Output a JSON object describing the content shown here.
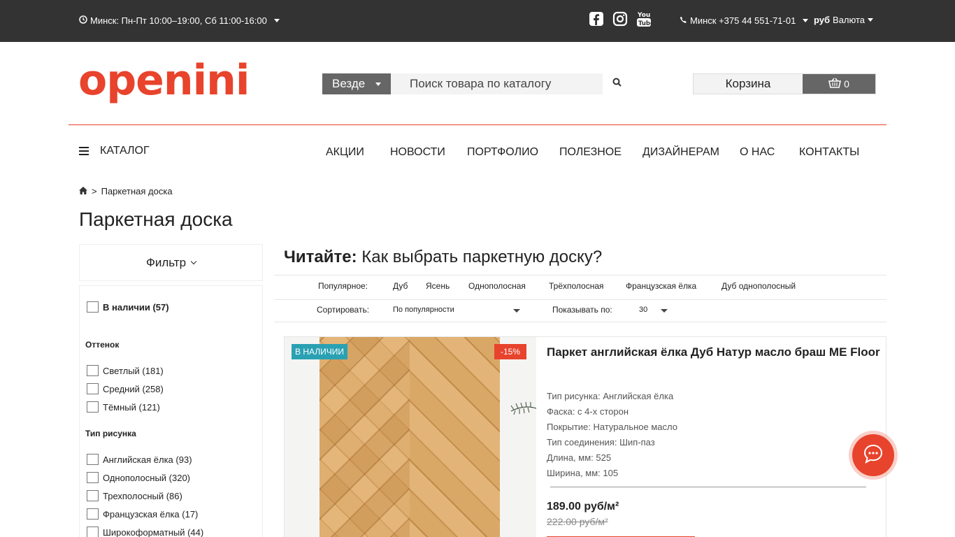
{
  "topbar": {
    "hours": "Минск: Пн-Пт 10:00–19:00, Сб 11:00-16:00",
    "phone": "Минск +375 44 551-71-01",
    "currency_code": "руб",
    "currency_label": "Валюта",
    "social_youtube_text": "You Tube"
  },
  "header": {
    "logo": "openini",
    "search_scope": "Везде",
    "search_placeholder": "Поиск товара по каталогу",
    "cart_label": "Корзина",
    "cart_count": "0"
  },
  "nav": {
    "catalog": "КАТАЛОГ",
    "items": [
      "АКЦИИ",
      "НОВОСТИ",
      "ПОРТФОЛИО",
      "ПОЛЕЗНОЕ",
      "ДИЗАЙНЕРАМ",
      "О НАС",
      "КОНТАКТЫ"
    ]
  },
  "breadcrumb": {
    "separator": ">",
    "current": "Паркетная доска"
  },
  "page_title": "Паркетная доска",
  "filter": {
    "toggle": "Фильтр",
    "in_stock": "В наличии (57)",
    "groups": [
      {
        "title": "Оттенок",
        "options": [
          "Светлый (181)",
          "Средний (258)",
          "Тёмный (121)"
        ]
      },
      {
        "title": "Тип рисунка",
        "options": [
          "Английская ёлка (93)",
          "Однополосный (320)",
          "Трехполосный (86)",
          "Французская ёлка (17)",
          "Широкоформатный (44)"
        ]
      }
    ]
  },
  "content": {
    "read_prefix": "Читайте:",
    "read_link": "Как выбрать паркетную доску?",
    "popular_label": "Популярное:",
    "popular": [
      "Дуб",
      "Ясень",
      "Однополосная",
      "Трёхполосная",
      "Французская ёлка",
      "Дуб однополосный"
    ],
    "sort_label": "Сортировать:",
    "sort_value": "По популярности",
    "show_label": "Показывать по:",
    "show_value": "30"
  },
  "product": {
    "badge_stock": "В НАЛИЧИИ",
    "badge_discount": "-15%",
    "title": "Паркет английская ёлка Дуб Натур масло браш ME Floor",
    "specs": [
      "Тип рисунка: Английская ёлка",
      "Фаска: с 4-х сторон",
      "Покрытие: Натуральное масло",
      "Тип соединения: Шип-паз",
      "Длина, мм: 525",
      "Ширина, мм: 105"
    ],
    "price": "189.00 руб/м²",
    "old_price": "222.00 руб/м²"
  },
  "colors": {
    "brand": "#e8432c",
    "topbar": "#333333",
    "stock_badge": "#2aa1b3",
    "gray_button": "#666666"
  }
}
